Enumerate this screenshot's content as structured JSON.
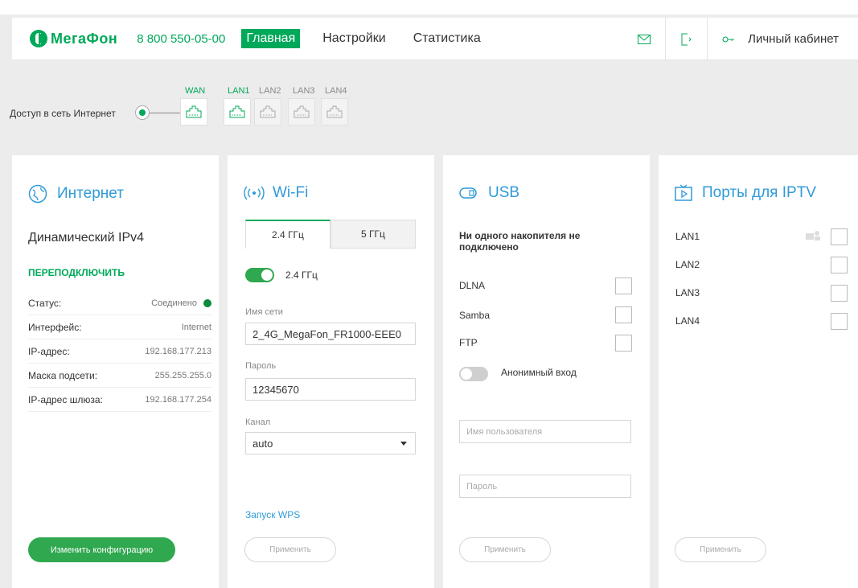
{
  "header": {
    "logo": "МегаФон",
    "phone": "8 800 550-05-00",
    "nav": [
      {
        "label": "Главная",
        "active": true
      },
      {
        "label": "Настройки",
        "active": false
      },
      {
        "label": "Статистика",
        "active": false
      }
    ],
    "cabinet": "Личный кабинет"
  },
  "ports": {
    "access_label": "Доступ в сеть Интернет",
    "wan": "WAN",
    "lan": [
      "LAN1",
      "LAN2",
      "LAN3",
      "LAN4"
    ]
  },
  "internet": {
    "title": "Интернет",
    "conn_type": "Динамический IPv4",
    "reconnect": "ПЕРЕПОДКЛЮЧИТЬ",
    "rows": [
      {
        "key": "Статус:",
        "value": "Соединено"
      },
      {
        "key": "Интерфейс:",
        "value": "Internet"
      },
      {
        "key": "IP-адрес:",
        "value": "192.168.177.213"
      },
      {
        "key": "Маска подсети:",
        "value": "255.255.255.0"
      },
      {
        "key": "IP-адрес шлюза:",
        "value": "192.168.177.254"
      }
    ],
    "change_btn": "Изменить конфигурацию"
  },
  "wifi": {
    "title": "Wi-Fi",
    "tabs": [
      "2.4 ГГц",
      "5 ГГц"
    ],
    "toggle_label": "2.4 ГГц",
    "ssid_label": "Имя сети",
    "ssid_value": "2_4G_MegaFon_FR1000-EEE0",
    "pass_label": "Пароль",
    "pass_value": "12345670",
    "channel_label": "Канал",
    "channel_value": "auto",
    "wps": "Запуск WPS",
    "apply": "Применить"
  },
  "usb": {
    "title": "USB",
    "message": "Ни одного накопителя не подключено",
    "services": [
      "DLNA",
      "Samba",
      "FTP"
    ],
    "anon_label": "Анонимный вход",
    "user_placeholder": "Имя пользователя",
    "pass_placeholder": "Пароль",
    "apply": "Применить"
  },
  "iptv": {
    "title": "Порты для IPTV",
    "ports": [
      "LAN1",
      "LAN2",
      "LAN3",
      "LAN4"
    ],
    "apply": "Применить"
  },
  "colors": {
    "brand": "#00a859",
    "accent": "#2f9ad8"
  }
}
